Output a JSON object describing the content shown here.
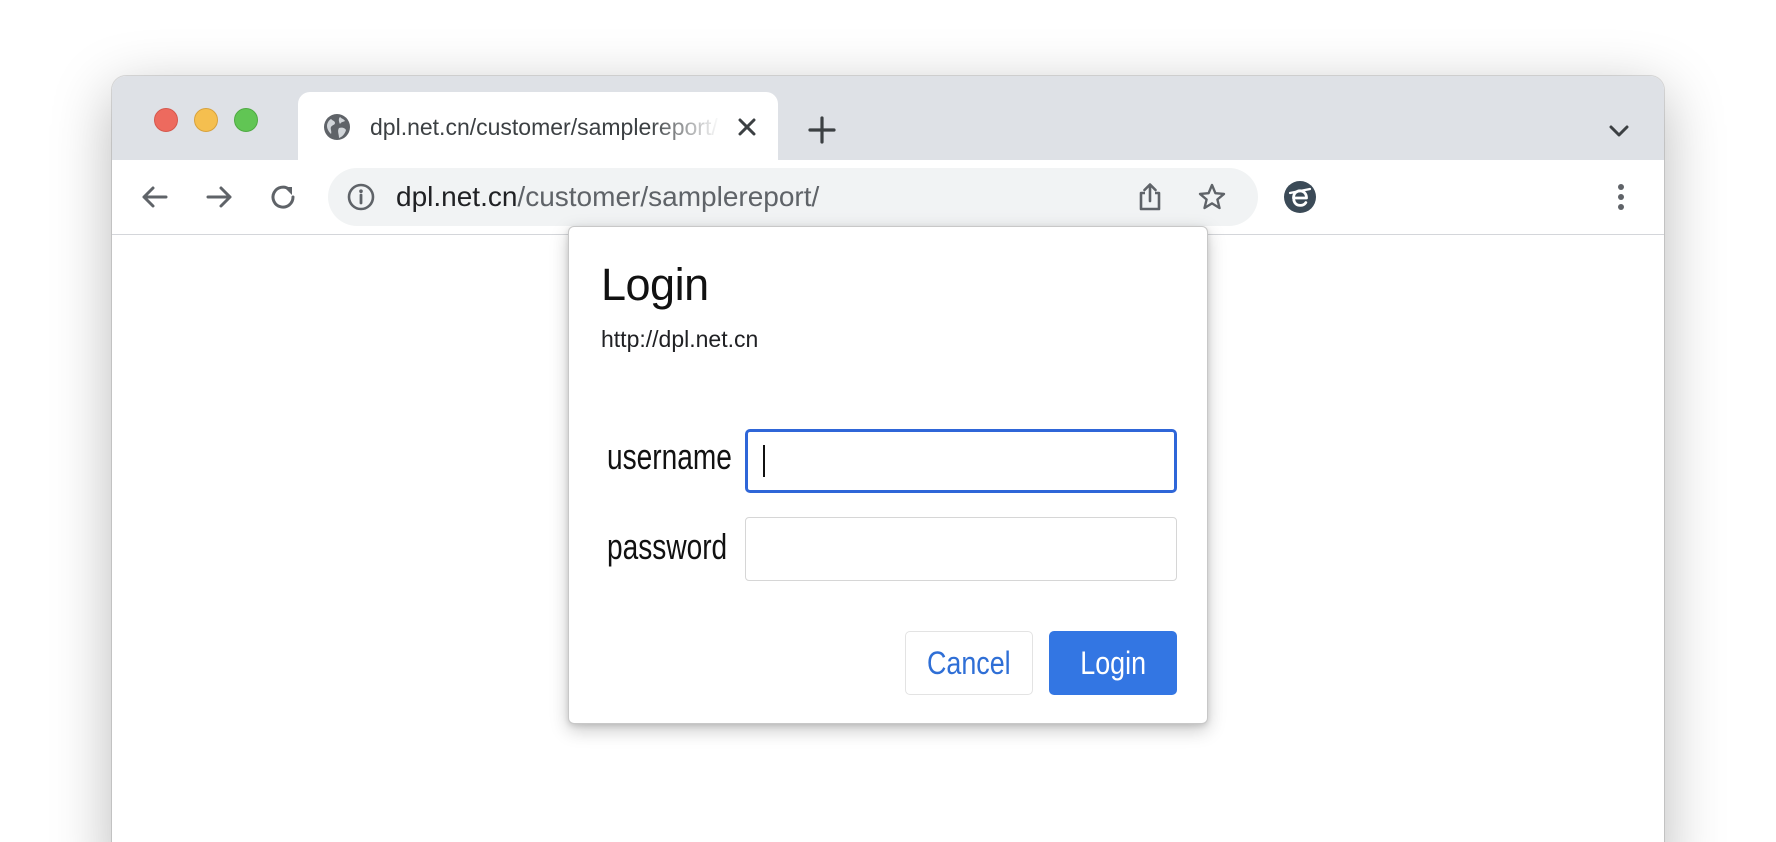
{
  "browser": {
    "tab": {
      "title": "dpl.net.cn/customer/samplereport/",
      "favicon": "globe-icon"
    },
    "omnibox": {
      "host": "dpl.net.cn",
      "path": "/customer/samplereport/",
      "leading_icon": "info-icon"
    },
    "toolbar_icons": [
      "back-icon",
      "forward-icon",
      "reload-icon",
      "share-icon",
      "star-icon",
      "extension-icon",
      "kebab-menu-icon"
    ],
    "colors": {
      "titlebar": "#dee1e6",
      "omnibox": "#f1f3f4",
      "traffic_red": "#ed6a5e",
      "traffic_yellow": "#f5bf4f",
      "traffic_green": "#61c554"
    }
  },
  "login_dialog": {
    "title": "Login",
    "origin": "http://dpl.net.cn",
    "username_label": "username",
    "username_value": "",
    "password_label": "password",
    "password_value": "",
    "cancel_label": "Cancel",
    "login_label": "Login",
    "colors": {
      "focus_ring": "#2f66d8",
      "primary_button": "#3376e3",
      "cancel_text": "#2f6fd6"
    }
  }
}
